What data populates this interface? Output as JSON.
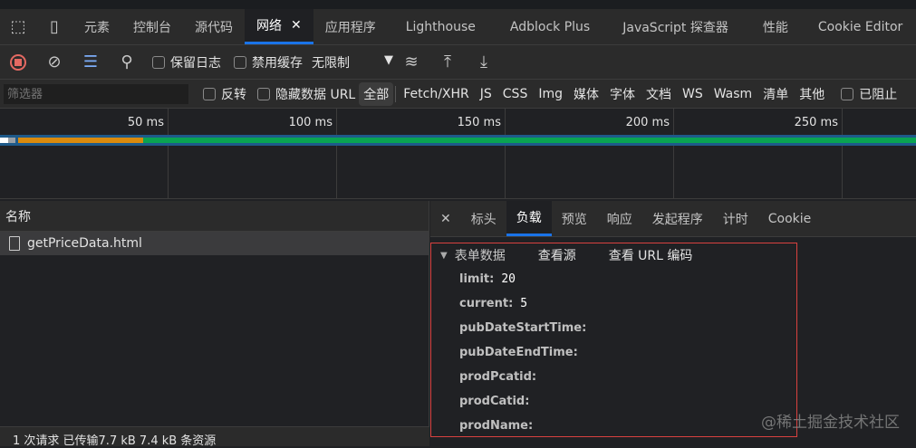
{
  "tabs": [
    "元素",
    "控制台",
    "源代码",
    "网络",
    "应用程序",
    "Lighthouse",
    "Adblock Plus",
    "JavaScript 探查器",
    "性能",
    "Cookie Editor"
  ],
  "toolbar": {
    "preserve_log": "保留日志",
    "disable_cache": "禁用缓存",
    "throttle": "无限制"
  },
  "filter": {
    "placeholder": "筛选器",
    "invert": "反转",
    "hide_data_url": "隐藏数据 URL",
    "types": [
      "全部",
      "Fetch/XHR",
      "JS",
      "CSS",
      "Img",
      "媒体",
      "字体",
      "文档",
      "WS",
      "Wasm",
      "清单",
      "其他"
    ],
    "blocked": "已阻止"
  },
  "timeline": {
    "ticks": [
      "50 ms",
      "100 ms",
      "150 ms",
      "200 ms",
      "250 ms"
    ]
  },
  "requests": {
    "header": "名称",
    "items": [
      "getPriceData.html"
    ],
    "status": "1 次请求  已传输7.7 kB  7.4 kB 条资源"
  },
  "detail": {
    "tabs": [
      "标头",
      "负载",
      "预览",
      "响应",
      "发起程序",
      "计时",
      "Cookie"
    ],
    "section": "表单数据",
    "view_source": "查看源",
    "view_url_encoded": "查看 URL 编码",
    "fields": [
      {
        "k": "limit:",
        "v": "20"
      },
      {
        "k": "current:",
        "v": "5"
      },
      {
        "k": "pubDateStartTime:",
        "v": ""
      },
      {
        "k": "pubDateEndTime:",
        "v": ""
      },
      {
        "k": "prodPcatid:",
        "v": ""
      },
      {
        "k": "prodCatid:",
        "v": ""
      },
      {
        "k": "prodName:",
        "v": ""
      }
    ]
  },
  "watermark": "@稀土掘金技术社区"
}
